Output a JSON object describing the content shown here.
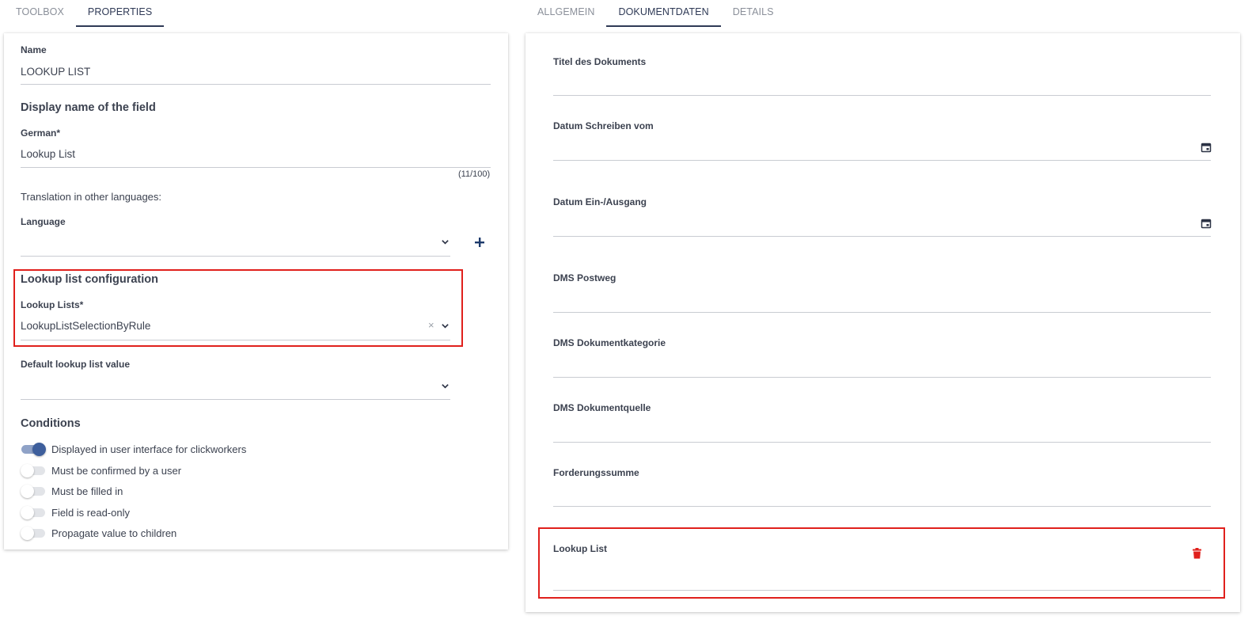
{
  "left_tabs": [
    {
      "label": "TOOLBOX",
      "active": false
    },
    {
      "label": "PROPERTIES",
      "active": true
    }
  ],
  "right_tabs": [
    {
      "label": "ALLGEMEIN",
      "active": false
    },
    {
      "label": "DOKUMENTDATEN",
      "active": true
    },
    {
      "label": "DETAILS",
      "active": false
    }
  ],
  "properties": {
    "name_label": "Name",
    "name_value": "LOOKUP LIST",
    "display_name_heading": "Display name of the field",
    "german_label": "German*",
    "german_value": "Lookup List",
    "char_counter": "(11/100)",
    "translation_text": "Translation in other languages:",
    "language_label": "Language",
    "language_value": "",
    "add_icon": "plus-icon",
    "lookup_config_heading": "Lookup list configuration",
    "lookup_lists_label": "Lookup Lists*",
    "lookup_lists_value": "LookupListSelectionByRule",
    "clear_glyph": "×",
    "default_value_label": "Default lookup list value",
    "default_value_value": "",
    "conditions_heading": "Conditions",
    "conditions": [
      {
        "label": "Displayed in user interface for clickworkers",
        "on": true
      },
      {
        "label": "Must be confirmed by a user",
        "on": false
      },
      {
        "label": "Must be filled in",
        "on": false
      },
      {
        "label": "Field is read-only",
        "on": false
      },
      {
        "label": "Propagate value to children",
        "on": false
      }
    ]
  },
  "document_fields": [
    {
      "label": "Titel des Dokuments",
      "icon": ""
    },
    {
      "label": "Datum Schreiben vom",
      "icon": "calendar-icon"
    },
    {
      "label": "Datum Ein-/Ausgang",
      "icon": "calendar-icon"
    },
    {
      "label": "DMS Postweg",
      "icon": ""
    },
    {
      "label": "DMS Dokumentkategorie",
      "icon": ""
    },
    {
      "label": "DMS Dokumentquelle",
      "icon": ""
    },
    {
      "label": "Forderungssumme",
      "icon": ""
    },
    {
      "label": "Lookup List",
      "icon": "trash-icon"
    }
  ],
  "colors": {
    "accent": "#2f3a56",
    "highlight_border": "#e0201c",
    "delete_icon": "#e0201c",
    "toggle_on": "#3e5f9c"
  }
}
